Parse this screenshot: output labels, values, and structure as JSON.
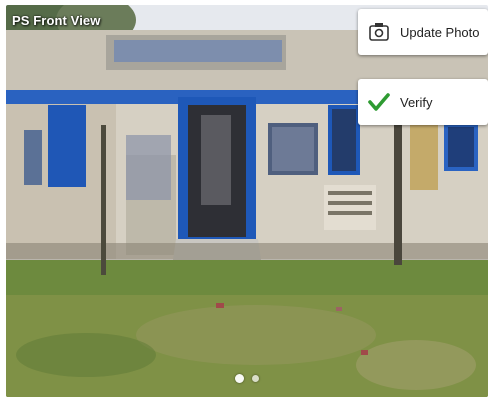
{
  "photo": {
    "title": "PS Front View",
    "description_hidden": false
  },
  "actions": {
    "update_label": "Update Photo",
    "verify_label": "Verify"
  },
  "carousel": {
    "total": 2,
    "active_index": 0
  },
  "colors": {
    "verify_check": "#2e9b32",
    "door_blue": "#1e58b8",
    "wall": "#d8d2c4",
    "ground_green": "#6f8e3f"
  }
}
